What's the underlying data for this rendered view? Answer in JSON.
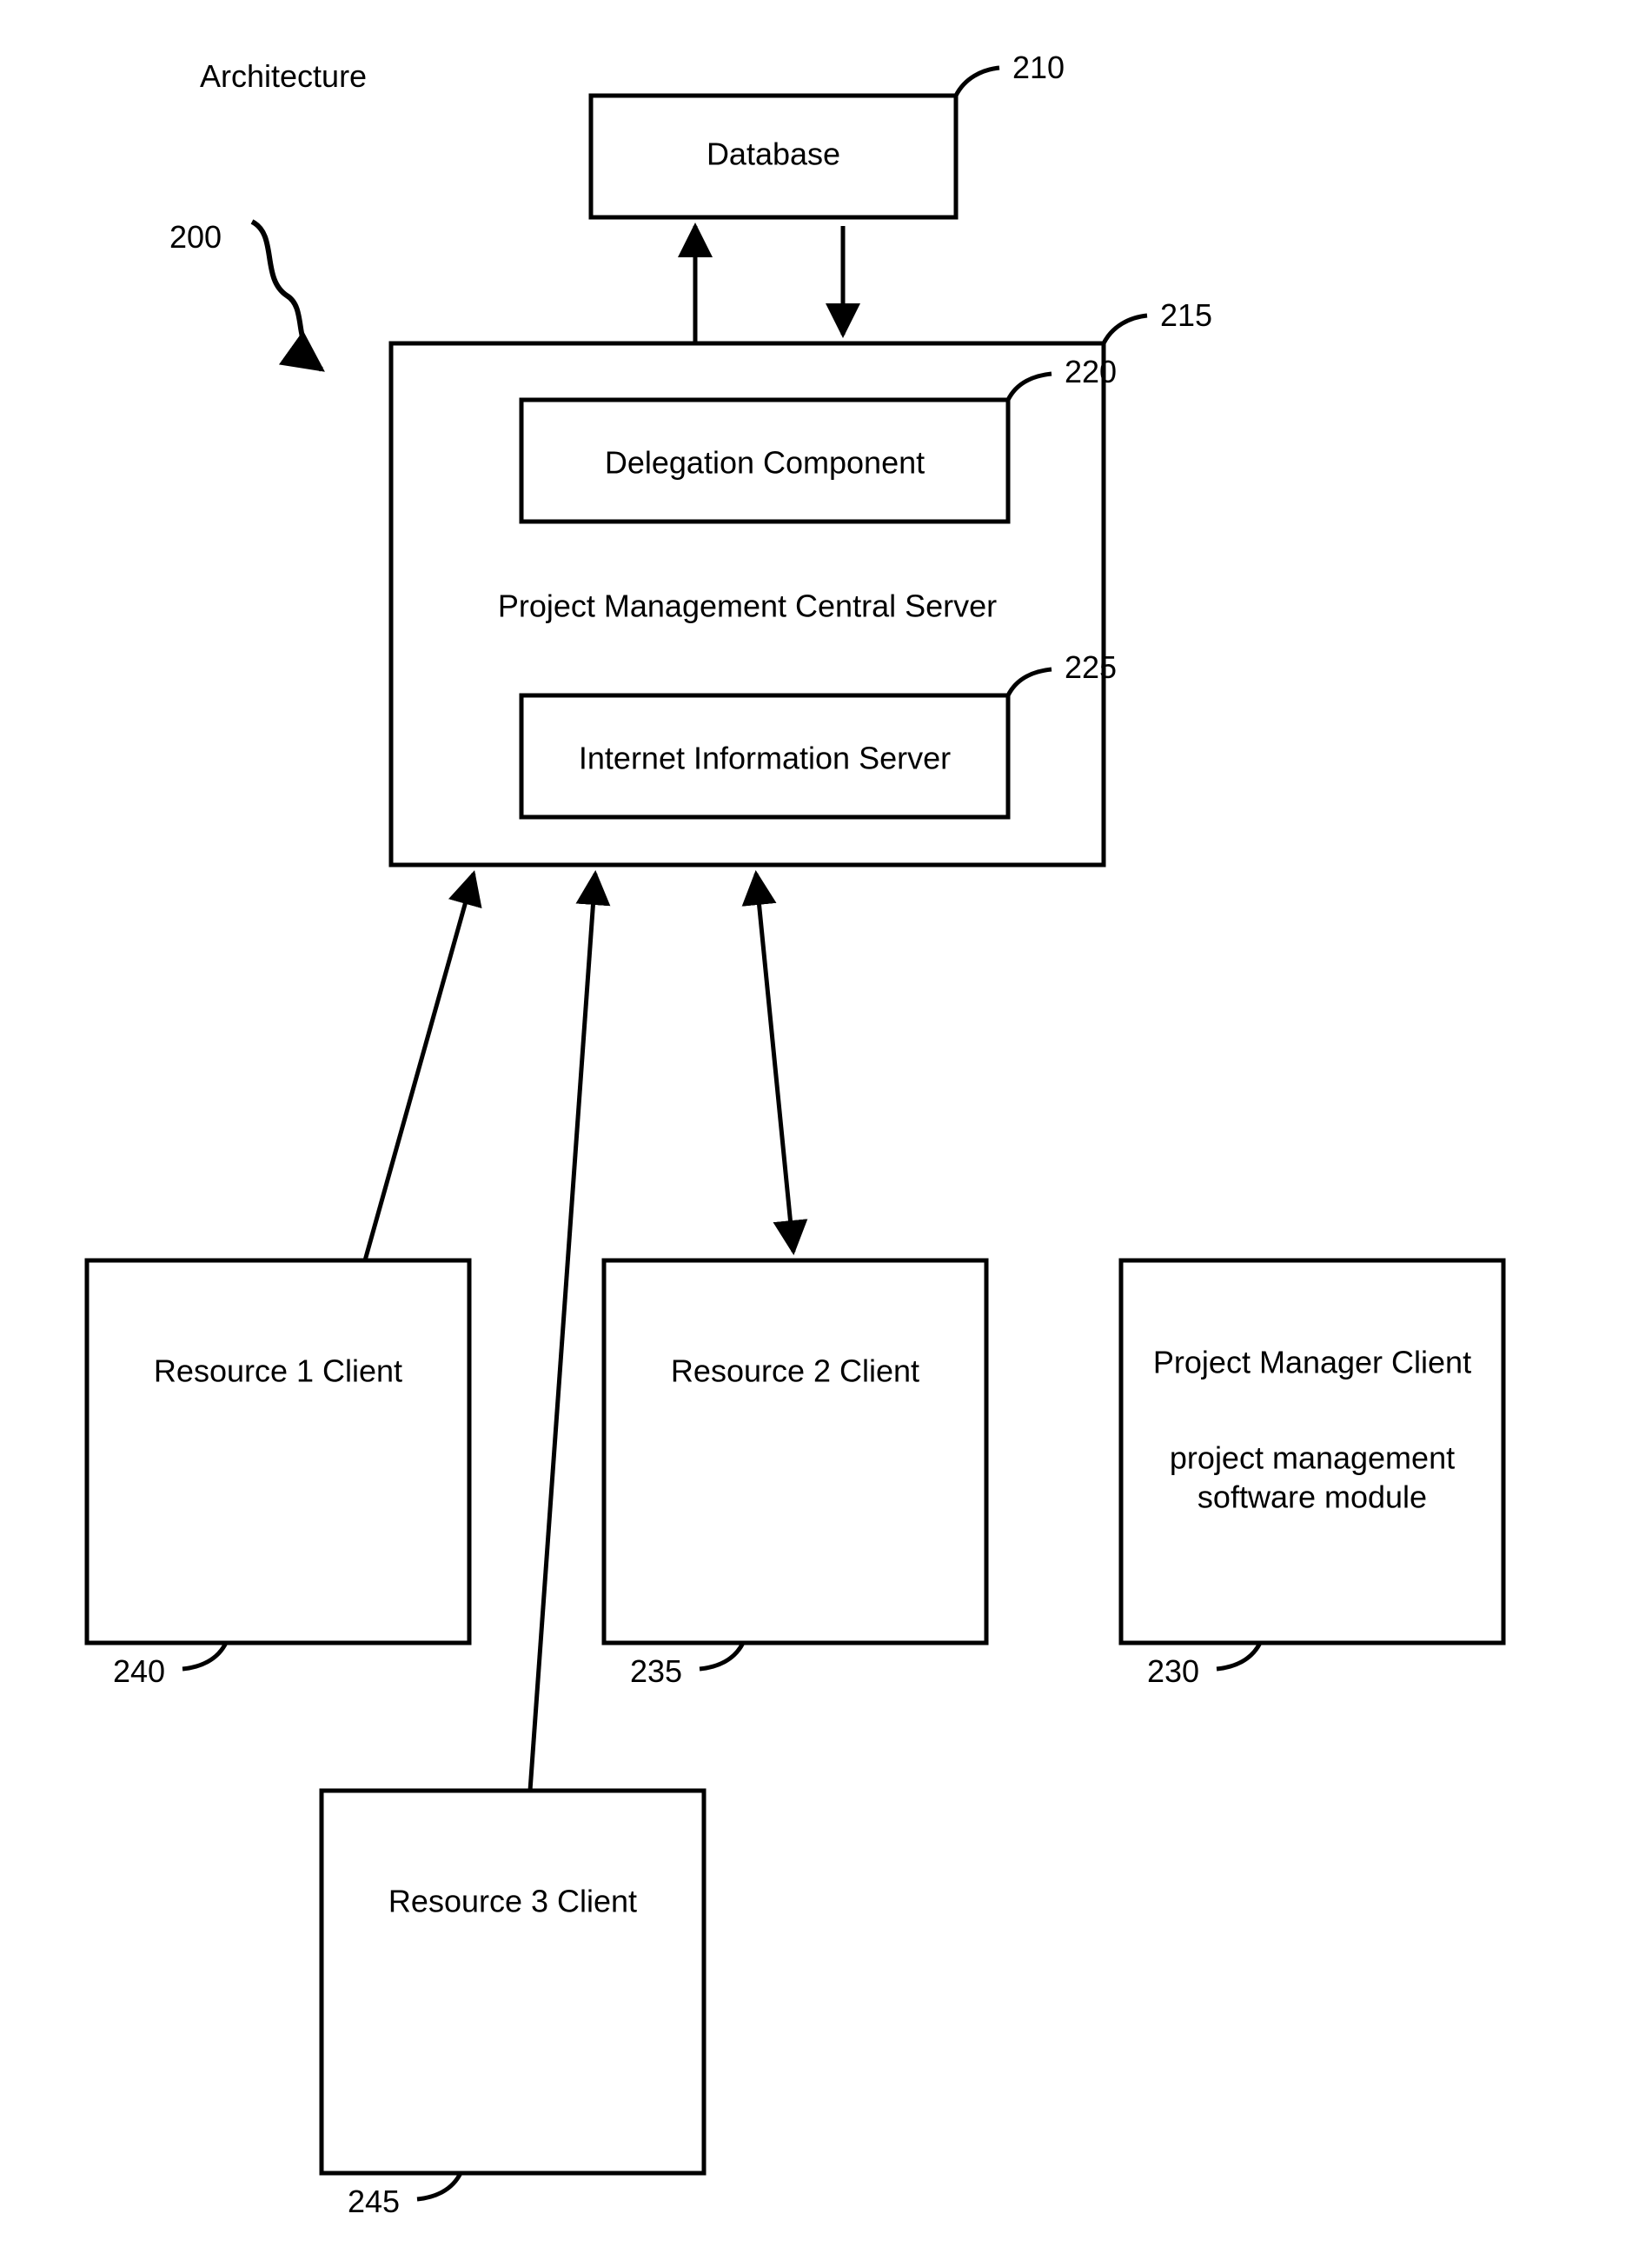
{
  "title": "Architecture",
  "refs": {
    "fig": "200",
    "database": "210",
    "server": "215",
    "delegation": "220",
    "iis": "225",
    "pmclient": "230",
    "resource2": "235",
    "resource1": "240",
    "resource3": "245"
  },
  "labels": {
    "database": "Database",
    "server": "Project Management Central Server",
    "delegation": "Delegation Component",
    "iis": "Internet Information Server",
    "resource1": "Resource 1 Client",
    "resource2": "Resource 2 Client",
    "resource3": "Resource 3 Client",
    "pmclient_l1": "Project Manager Client",
    "pmclient_l2": "project management",
    "pmclient_l3": "software module"
  }
}
